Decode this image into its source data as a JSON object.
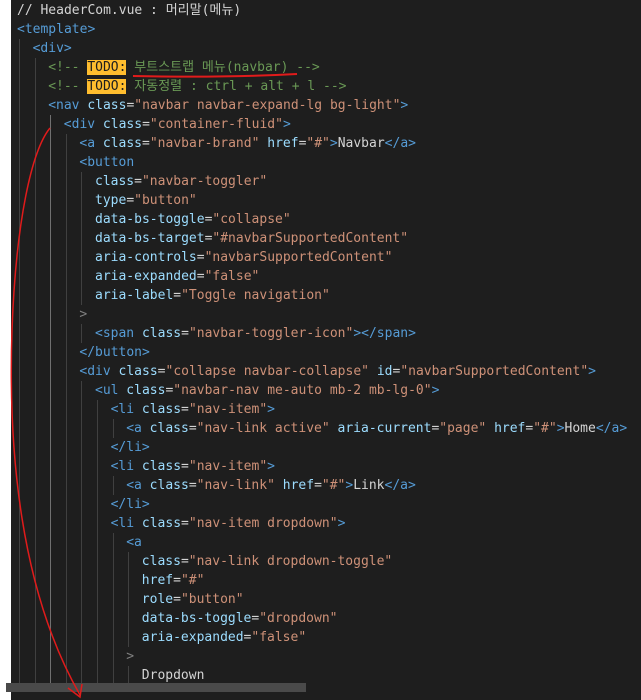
{
  "colors": {
    "annotation": "#e11b1b",
    "todo_bg": "#ffbd2e"
  },
  "lines": [
    {
      "indent": 0,
      "tokens": [
        {
          "t": "// HeaderCom.vue : 머리말(메뉴)",
          "c": "t-text"
        }
      ]
    },
    {
      "indent": 0,
      "tokens": [
        {
          "t": "<template>",
          "c": "t-tag"
        }
      ]
    },
    {
      "indent": 1,
      "tokens": [
        {
          "t": "<div>",
          "c": "t-tag"
        }
      ]
    },
    {
      "indent": 2,
      "tokens": [
        {
          "t": "<!-- ",
          "c": "t-comment"
        },
        {
          "t": "TODO:",
          "c": "t-todo"
        },
        {
          "t": " 부트스트랩 메뉴(navbar) -->",
          "c": "t-comment"
        }
      ]
    },
    {
      "indent": 2,
      "tokens": [
        {
          "t": "<!-- ",
          "c": "t-comment"
        },
        {
          "t": "TODO:",
          "c": "t-todo"
        },
        {
          "t": " 자동정렬 : ctrl + alt + l -->",
          "c": "t-comment"
        }
      ]
    },
    {
      "indent": 2,
      "tokens": [
        {
          "t": "<nav",
          "c": "t-tag"
        },
        {
          "t": " class",
          "c": "t-attr"
        },
        {
          "t": "=",
          "c": "t-text"
        },
        {
          "t": "\"navbar navbar-expand-lg bg-light\"",
          "c": "t-str"
        },
        {
          "t": ">",
          "c": "t-tag"
        }
      ]
    },
    {
      "indent": 3,
      "tokens": [
        {
          "t": "<div",
          "c": "t-tag"
        },
        {
          "t": " class",
          "c": "t-attr"
        },
        {
          "t": "=",
          "c": "t-text"
        },
        {
          "t": "\"container-fluid\"",
          "c": "t-str"
        },
        {
          "t": ">",
          "c": "t-tag"
        }
      ]
    },
    {
      "indent": 4,
      "tokens": [
        {
          "t": "<a",
          "c": "t-tag"
        },
        {
          "t": " class",
          "c": "t-attr"
        },
        {
          "t": "=",
          "c": "t-text"
        },
        {
          "t": "\"navbar-brand\"",
          "c": "t-str"
        },
        {
          "t": " href",
          "c": "t-attr"
        },
        {
          "t": "=",
          "c": "t-text"
        },
        {
          "t": "\"#\"",
          "c": "t-str"
        },
        {
          "t": ">",
          "c": "t-tag"
        },
        {
          "t": "Navbar",
          "c": "t-text"
        },
        {
          "t": "</a>",
          "c": "t-tag"
        }
      ]
    },
    {
      "indent": 4,
      "tokens": [
        {
          "t": "<button",
          "c": "t-tag"
        }
      ]
    },
    {
      "indent": 5,
      "tokens": [
        {
          "t": "class",
          "c": "t-attr"
        },
        {
          "t": "=",
          "c": "t-text"
        },
        {
          "t": "\"navbar-toggler\"",
          "c": "t-str"
        }
      ]
    },
    {
      "indent": 5,
      "tokens": [
        {
          "t": "type",
          "c": "t-attr"
        },
        {
          "t": "=",
          "c": "t-text"
        },
        {
          "t": "\"button\"",
          "c": "t-str"
        }
      ]
    },
    {
      "indent": 5,
      "tokens": [
        {
          "t": "data-bs-toggle",
          "c": "t-attr"
        },
        {
          "t": "=",
          "c": "t-text"
        },
        {
          "t": "\"collapse\"",
          "c": "t-str"
        }
      ]
    },
    {
      "indent": 5,
      "tokens": [
        {
          "t": "data-bs-target",
          "c": "t-attr"
        },
        {
          "t": "=",
          "c": "t-text"
        },
        {
          "t": "\"#navbarSupportedContent\"",
          "c": "t-str"
        }
      ]
    },
    {
      "indent": 5,
      "tokens": [
        {
          "t": "aria-controls",
          "c": "t-attr"
        },
        {
          "t": "=",
          "c": "t-text"
        },
        {
          "t": "\"navbarSupportedContent\"",
          "c": "t-str"
        }
      ]
    },
    {
      "indent": 5,
      "tokens": [
        {
          "t": "aria-expanded",
          "c": "t-attr"
        },
        {
          "t": "=",
          "c": "t-text"
        },
        {
          "t": "\"false\"",
          "c": "t-str"
        }
      ]
    },
    {
      "indent": 5,
      "tokens": [
        {
          "t": "aria-label",
          "c": "t-attr"
        },
        {
          "t": "=",
          "c": "t-text"
        },
        {
          "t": "\"Toggle navigation\"",
          "c": "t-str"
        }
      ]
    },
    {
      "indent": 4,
      "tokens": [
        {
          "t": ">",
          "c": "t-punc"
        }
      ]
    },
    {
      "indent": 5,
      "tokens": [
        {
          "t": "<span",
          "c": "t-tag"
        },
        {
          "t": " class",
          "c": "t-attr"
        },
        {
          "t": "=",
          "c": "t-text"
        },
        {
          "t": "\"navbar-toggler-icon\"",
          "c": "t-str"
        },
        {
          "t": "></span>",
          "c": "t-tag"
        }
      ]
    },
    {
      "indent": 4,
      "tokens": [
        {
          "t": "</button>",
          "c": "t-tag"
        }
      ]
    },
    {
      "indent": 4,
      "tokens": [
        {
          "t": "<div",
          "c": "t-tag"
        },
        {
          "t": " class",
          "c": "t-attr"
        },
        {
          "t": "=",
          "c": "t-text"
        },
        {
          "t": "\"collapse navbar-collapse\"",
          "c": "t-str"
        },
        {
          "t": " id",
          "c": "t-attr"
        },
        {
          "t": "=",
          "c": "t-text"
        },
        {
          "t": "\"navbarSupportedContent\"",
          "c": "t-str"
        },
        {
          "t": ">",
          "c": "t-tag"
        }
      ]
    },
    {
      "indent": 5,
      "tokens": [
        {
          "t": "<ul",
          "c": "t-tag"
        },
        {
          "t": " class",
          "c": "t-attr"
        },
        {
          "t": "=",
          "c": "t-text"
        },
        {
          "t": "\"navbar-nav me-auto mb-2 mb-lg-0\"",
          "c": "t-str"
        },
        {
          "t": ">",
          "c": "t-tag"
        }
      ]
    },
    {
      "indent": 6,
      "tokens": [
        {
          "t": "<li",
          "c": "t-tag"
        },
        {
          "t": " class",
          "c": "t-attr"
        },
        {
          "t": "=",
          "c": "t-text"
        },
        {
          "t": "\"nav-item\"",
          "c": "t-str"
        },
        {
          "t": ">",
          "c": "t-tag"
        }
      ]
    },
    {
      "indent": 7,
      "tokens": [
        {
          "t": "<a",
          "c": "t-tag"
        },
        {
          "t": " class",
          "c": "t-attr"
        },
        {
          "t": "=",
          "c": "t-text"
        },
        {
          "t": "\"nav-link active\"",
          "c": "t-str"
        },
        {
          "t": " aria-current",
          "c": "t-attr"
        },
        {
          "t": "=",
          "c": "t-text"
        },
        {
          "t": "\"page\"",
          "c": "t-str"
        },
        {
          "t": " href",
          "c": "t-attr"
        },
        {
          "t": "=",
          "c": "t-text"
        },
        {
          "t": "\"#\"",
          "c": "t-str"
        },
        {
          "t": ">",
          "c": "t-tag"
        },
        {
          "t": "Home",
          "c": "t-text"
        },
        {
          "t": "</a>",
          "c": "t-tag"
        }
      ]
    },
    {
      "indent": 6,
      "tokens": [
        {
          "t": "</li>",
          "c": "t-tag"
        }
      ]
    },
    {
      "indent": 6,
      "tokens": [
        {
          "t": "<li",
          "c": "t-tag"
        },
        {
          "t": " class",
          "c": "t-attr"
        },
        {
          "t": "=",
          "c": "t-text"
        },
        {
          "t": "\"nav-item\"",
          "c": "t-str"
        },
        {
          "t": ">",
          "c": "t-tag"
        }
      ]
    },
    {
      "indent": 7,
      "tokens": [
        {
          "t": "<a",
          "c": "t-tag"
        },
        {
          "t": " class",
          "c": "t-attr"
        },
        {
          "t": "=",
          "c": "t-text"
        },
        {
          "t": "\"nav-link\"",
          "c": "t-str"
        },
        {
          "t": " href",
          "c": "t-attr"
        },
        {
          "t": "=",
          "c": "t-text"
        },
        {
          "t": "\"#\"",
          "c": "t-str"
        },
        {
          "t": ">",
          "c": "t-tag"
        },
        {
          "t": "Link",
          "c": "t-text"
        },
        {
          "t": "</a>",
          "c": "t-tag"
        }
      ]
    },
    {
      "indent": 6,
      "tokens": [
        {
          "t": "</li>",
          "c": "t-tag"
        }
      ]
    },
    {
      "indent": 6,
      "tokens": [
        {
          "t": "<li",
          "c": "t-tag"
        },
        {
          "t": " class",
          "c": "t-attr"
        },
        {
          "t": "=",
          "c": "t-text"
        },
        {
          "t": "\"nav-item dropdown\"",
          "c": "t-str"
        },
        {
          "t": ">",
          "c": "t-tag"
        }
      ]
    },
    {
      "indent": 7,
      "tokens": [
        {
          "t": "<a",
          "c": "t-tag"
        }
      ]
    },
    {
      "indent": 8,
      "tokens": [
        {
          "t": "class",
          "c": "t-attr"
        },
        {
          "t": "=",
          "c": "t-text"
        },
        {
          "t": "\"nav-link dropdown-toggle\"",
          "c": "t-str"
        }
      ]
    },
    {
      "indent": 8,
      "tokens": [
        {
          "t": "href",
          "c": "t-attr"
        },
        {
          "t": "=",
          "c": "t-text"
        },
        {
          "t": "\"#\"",
          "c": "t-str"
        }
      ]
    },
    {
      "indent": 8,
      "tokens": [
        {
          "t": "role",
          "c": "t-attr"
        },
        {
          "t": "=",
          "c": "t-text"
        },
        {
          "t": "\"button\"",
          "c": "t-str"
        }
      ]
    },
    {
      "indent": 8,
      "tokens": [
        {
          "t": "data-bs-toggle",
          "c": "t-attr"
        },
        {
          "t": "=",
          "c": "t-text"
        },
        {
          "t": "\"dropdown\"",
          "c": "t-str"
        }
      ]
    },
    {
      "indent": 8,
      "tokens": [
        {
          "t": "aria-expanded",
          "c": "t-attr"
        },
        {
          "t": "=",
          "c": "t-text"
        },
        {
          "t": "\"false\"",
          "c": "t-str"
        }
      ]
    },
    {
      "indent": 7,
      "tokens": [
        {
          "t": ">",
          "c": "t-punc"
        }
      ]
    },
    {
      "indent": 8,
      "tokens": [
        {
          "t": "Dropdown",
          "c": "t-text"
        }
      ]
    }
  ]
}
